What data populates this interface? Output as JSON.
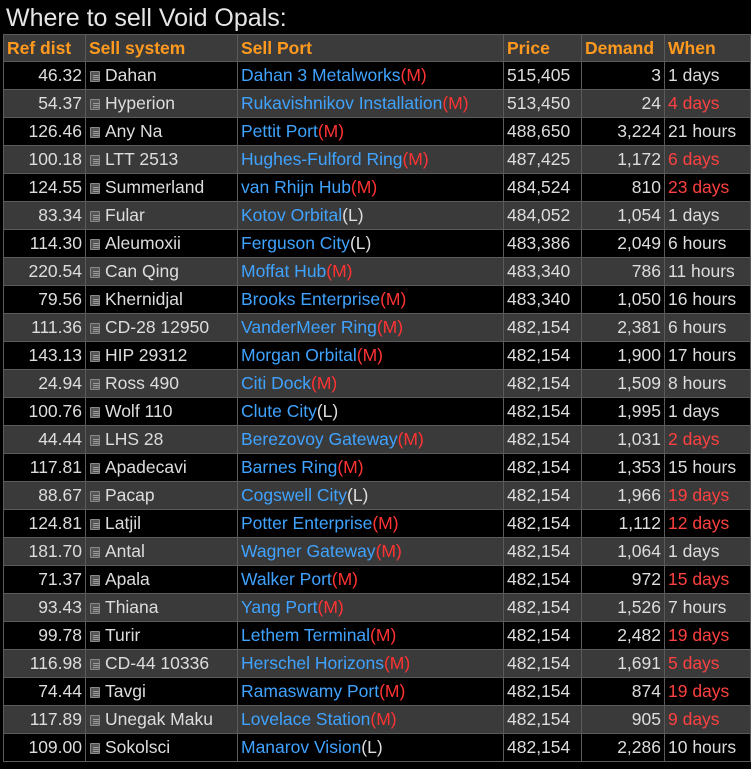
{
  "title": "Where to sell Void Opals:",
  "colors": {
    "header_text": "#ff9a1f",
    "port_link": "#3fa3ff",
    "pad_medium": "#ff3333",
    "stale_time": "#ff4040"
  },
  "columns": [
    "Ref dist",
    "Sell system",
    "Sell Port",
    "Price",
    "Demand",
    "When"
  ],
  "rows": [
    {
      "dist": "46.32",
      "system": "Dahan",
      "port": "Dahan 3 Metalworks",
      "pad": "(M)",
      "price": "515,405",
      "demand": "3",
      "when": "1 days",
      "stale": false
    },
    {
      "dist": "54.37",
      "system": "Hyperion",
      "port": "Rukavishnikov Installation",
      "pad": "(M)",
      "price": "513,450",
      "demand": "24",
      "when": "4 days",
      "stale": true
    },
    {
      "dist": "126.46",
      "system": "Any Na",
      "port": "Pettit Port",
      "pad": "(M)",
      "price": "488,650",
      "demand": "3,224",
      "when": "21 hours",
      "stale": false
    },
    {
      "dist": "100.18",
      "system": "LTT 2513",
      "port": "Hughes-Fulford Ring",
      "pad": "(M)",
      "price": "487,425",
      "demand": "1,172",
      "when": "6 days",
      "stale": true
    },
    {
      "dist": "124.55",
      "system": "Summerland",
      "port": "van Rhijn Hub",
      "pad": "(M)",
      "price": "484,524",
      "demand": "810",
      "when": "23 days",
      "stale": true
    },
    {
      "dist": "83.34",
      "system": "Fular",
      "port": "Kotov Orbital",
      "pad": "(L)",
      "price": "484,052",
      "demand": "1,054",
      "when": "1 days",
      "stale": false
    },
    {
      "dist": "114.30",
      "system": "Aleumoxii",
      "port": "Ferguson City",
      "pad": "(L)",
      "price": "483,386",
      "demand": "2,049",
      "when": "6 hours",
      "stale": false
    },
    {
      "dist": "220.54",
      "system": "Can Qing",
      "port": "Moffat Hub",
      "pad": "(M)",
      "price": "483,340",
      "demand": "786",
      "when": "11 hours",
      "stale": false
    },
    {
      "dist": "79.56",
      "system": "Khernidjal",
      "port": "Brooks Enterprise",
      "pad": "(M)",
      "price": "483,340",
      "demand": "1,050",
      "when": "16 hours",
      "stale": false
    },
    {
      "dist": "111.36",
      "system": "CD-28 12950",
      "port": "VanderMeer Ring",
      "pad": "(M)",
      "price": "482,154",
      "demand": "2,381",
      "when": "6 hours",
      "stale": false
    },
    {
      "dist": "143.13",
      "system": "HIP 29312",
      "port": "Morgan Orbital",
      "pad": "(M)",
      "price": "482,154",
      "demand": "1,900",
      "when": "17 hours",
      "stale": false
    },
    {
      "dist": "24.94",
      "system": "Ross 490",
      "port": "Citi Dock",
      "pad": "(M)",
      "price": "482,154",
      "demand": "1,509",
      "when": "8 hours",
      "stale": false
    },
    {
      "dist": "100.76",
      "system": "Wolf 110",
      "port": "Clute City",
      "pad": "(L)",
      "price": "482,154",
      "demand": "1,995",
      "when": "1 days",
      "stale": false
    },
    {
      "dist": "44.44",
      "system": "LHS 28",
      "port": "Berezovoy Gateway",
      "pad": "(M)",
      "price": "482,154",
      "demand": "1,031",
      "when": "2 days",
      "stale": true
    },
    {
      "dist": "117.81",
      "system": "Apadecavi",
      "port": "Barnes Ring",
      "pad": "(M)",
      "price": "482,154",
      "demand": "1,353",
      "when": "15 hours",
      "stale": false
    },
    {
      "dist": "88.67",
      "system": "Pacap",
      "port": "Cogswell City",
      "pad": "(L)",
      "price": "482,154",
      "demand": "1,966",
      "when": "19 days",
      "stale": true
    },
    {
      "dist": "124.81",
      "system": "Latjil",
      "port": "Potter Enterprise",
      "pad": "(M)",
      "price": "482,154",
      "demand": "1,112",
      "when": "12 days",
      "stale": true
    },
    {
      "dist": "181.70",
      "system": "Antal",
      "port": "Wagner Gateway",
      "pad": "(M)",
      "price": "482,154",
      "demand": "1,064",
      "when": "1 days",
      "stale": false
    },
    {
      "dist": "71.37",
      "system": "Apala",
      "port": "Walker Port",
      "pad": "(M)",
      "price": "482,154",
      "demand": "972",
      "when": "15 days",
      "stale": true
    },
    {
      "dist": "93.43",
      "system": "Thiana",
      "port": "Yang Port",
      "pad": "(M)",
      "price": "482,154",
      "demand": "1,526",
      "when": "7 hours",
      "stale": false
    },
    {
      "dist": "99.78",
      "system": "Turir",
      "port": "Lethem Terminal",
      "pad": "(M)",
      "price": "482,154",
      "demand": "2,482",
      "when": "19 days",
      "stale": true
    },
    {
      "dist": "116.98",
      "system": "CD-44 10336",
      "port": "Herschel Horizons",
      "pad": "(M)",
      "price": "482,154",
      "demand": "1,691",
      "when": "5 days",
      "stale": true
    },
    {
      "dist": "74.44",
      "system": "Tavgi",
      "port": "Ramaswamy Port",
      "pad": "(M)",
      "price": "482,154",
      "demand": "874",
      "when": "19 days",
      "stale": true
    },
    {
      "dist": "117.89",
      "system": "Unegak Maku",
      "port": "Lovelace Station",
      "pad": "(M)",
      "price": "482,154",
      "demand": "905",
      "when": "9 days",
      "stale": true
    },
    {
      "dist": "109.00",
      "system": "Sokolsci",
      "port": "Manarov Vision",
      "pad": "(L)",
      "price": "482,154",
      "demand": "2,286",
      "when": "10 hours",
      "stale": false
    }
  ]
}
